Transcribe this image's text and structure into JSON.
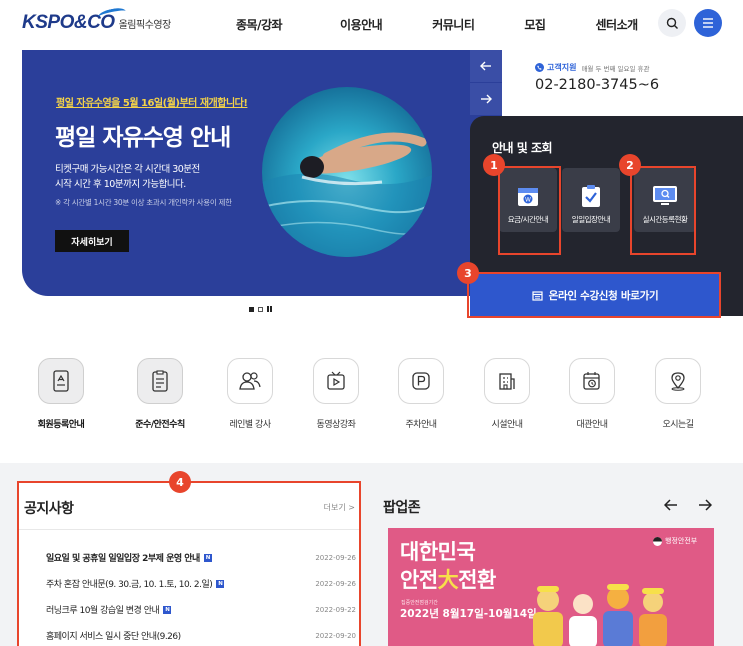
{
  "header": {
    "logo_text": "KSPO&CO",
    "logo_sub": "올림픽수영장",
    "nav": [
      "종목/강좌",
      "이용안내",
      "커뮤니티",
      "모집",
      "센터소개"
    ]
  },
  "hero": {
    "tag": "평일 자유수영을 5월 16일(월)부터 재개합니다!",
    "title": "평일 자유수영 안내",
    "desc": "티켓구매 가능시간은 각 시간대 30분전\n시작 시간 후 10분까지 가능합니다.",
    "note": "※ 각 시간별 1시간 30분 이상 초과시 개인락카 사용이 제한",
    "button": "자세히보기"
  },
  "contact": {
    "label": "고객지원",
    "note": "매월 두 번째 일요일 휴관",
    "phone": "02-2180-3745~6"
  },
  "info": {
    "title": "안내 및 조회",
    "tiles": [
      "요금/시간안내",
      "일일입장안내",
      "실시간등록현황"
    ],
    "online_button": "온라인 수강신청 바로가기"
  },
  "annotations": [
    "1",
    "2",
    "3",
    "4"
  ],
  "quick_menu": [
    "회원등록안내",
    "준수/안전수칙",
    "레인별 강사",
    "동영상강좌",
    "주차안내",
    "시설안내",
    "대관안내",
    "오시는길"
  ],
  "notice": {
    "title": "공지사항",
    "more": "더보기 >",
    "items": [
      {
        "title": "일요일 및 공휴일 일일입장 2부제 운영 안내",
        "date": "2022-09-26",
        "bold": true
      },
      {
        "title": "주차 혼잡 안내문(9. 30.금, 10. 1.토, 10. 2.일)",
        "date": "2022-09-26",
        "bold": false
      },
      {
        "title": "러닝크루 10월 강습일 변경 안내",
        "date": "2022-09-22",
        "bold": false
      },
      {
        "title": "홈페이지 서비스 일시 중단 안내(9.26)",
        "date": "2022-09-20",
        "bold": false
      }
    ],
    "new_badge": "N"
  },
  "popup": {
    "title": "팝업존",
    "img_line1": "대한민국",
    "img_line2_a": "안전",
    "img_line2_b": "大",
    "img_line2_c": "전환",
    "img_small": "집중안전점검기간",
    "img_date": "2022년 8월17일-10월14일",
    "img_logo": "행정안전부"
  },
  "colors": {
    "brand_blue": "#2e57cd",
    "hero_bg": "#2b3f9a",
    "panel_dark": "#23252e",
    "annotation_red": "#e8452c",
    "accent_yellow": "#f3d249"
  }
}
